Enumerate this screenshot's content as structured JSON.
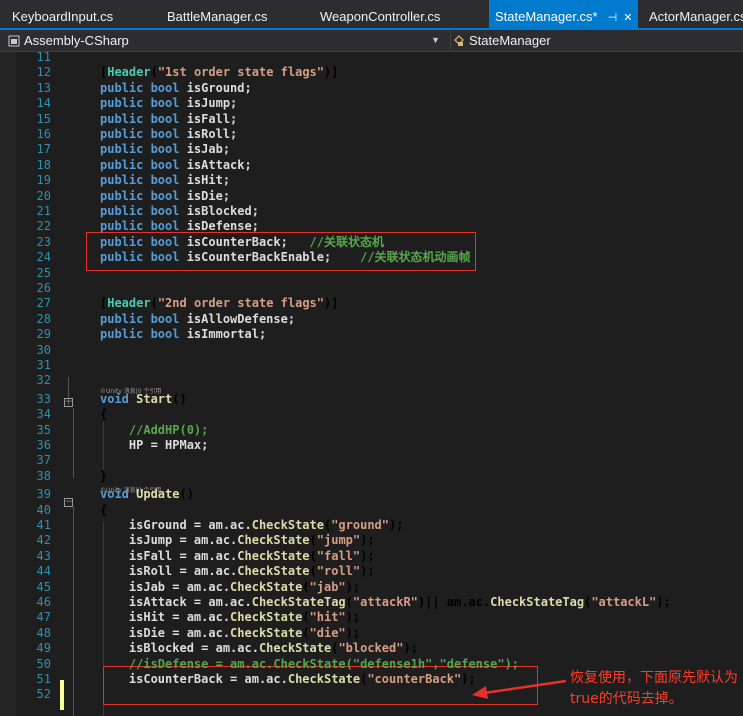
{
  "tabs": [
    {
      "label": "KeyboardInput.cs"
    },
    {
      "label": "BattleManager.cs"
    },
    {
      "label": "WeaponController.cs"
    },
    {
      "label": "StateManager.cs*",
      "active": true
    },
    {
      "label": "ActorManager.cs"
    }
  ],
  "nav": {
    "project": "Assembly-CSharp",
    "class": "StateManager"
  },
  "codelens": "©Unity 消息|0 个引用",
  "lines": [
    {
      "n": "11",
      "t": []
    },
    {
      "n": "12",
      "t": [
        [
          "[",
          ""
        ],
        [
          "Header",
          "ty"
        ],
        [
          "(",
          ""
        ],
        [
          "\"1st order state flags\"",
          "str"
        ],
        [
          ")]",
          ""
        ]
      ]
    },
    {
      "n": "13",
      "t": [
        [
          "public ",
          "kw"
        ],
        [
          "bool ",
          "kw"
        ],
        [
          "isGround;",
          "id"
        ]
      ]
    },
    {
      "n": "14",
      "t": [
        [
          "public ",
          "kw"
        ],
        [
          "bool ",
          "kw"
        ],
        [
          "isJump;",
          "id"
        ]
      ]
    },
    {
      "n": "15",
      "t": [
        [
          "public ",
          "kw"
        ],
        [
          "bool ",
          "kw"
        ],
        [
          "isFall;",
          "id"
        ]
      ]
    },
    {
      "n": "16",
      "t": [
        [
          "public ",
          "kw"
        ],
        [
          "bool ",
          "kw"
        ],
        [
          "isRoll;",
          "id"
        ]
      ]
    },
    {
      "n": "17",
      "t": [
        [
          "public ",
          "kw"
        ],
        [
          "bool ",
          "kw"
        ],
        [
          "isJab;",
          "id"
        ]
      ]
    },
    {
      "n": "18",
      "t": [
        [
          "public ",
          "kw"
        ],
        [
          "bool ",
          "kw"
        ],
        [
          "isAttack;",
          "id"
        ]
      ]
    },
    {
      "n": "19",
      "t": [
        [
          "public ",
          "kw"
        ],
        [
          "bool ",
          "kw"
        ],
        [
          "isHit;",
          "id"
        ]
      ]
    },
    {
      "n": "20",
      "t": [
        [
          "public ",
          "kw"
        ],
        [
          "bool ",
          "kw"
        ],
        [
          "isDie;",
          "id"
        ]
      ]
    },
    {
      "n": "21",
      "t": [
        [
          "public ",
          "kw"
        ],
        [
          "bool ",
          "kw"
        ],
        [
          "isBlocked;",
          "id"
        ]
      ]
    },
    {
      "n": "22",
      "t": [
        [
          "public ",
          "kw"
        ],
        [
          "bool ",
          "kw"
        ],
        [
          "isDefense;",
          "id"
        ]
      ]
    },
    {
      "n": "23",
      "t": [
        [
          "public ",
          "kw"
        ],
        [
          "bool ",
          "kw"
        ],
        [
          "isCounterBack;   ",
          "id"
        ],
        [
          "//关联状态机",
          "cm"
        ]
      ]
    },
    {
      "n": "24",
      "t": [
        [
          "public ",
          "kw"
        ],
        [
          "bool ",
          "kw"
        ],
        [
          "isCounterBackEnable;    ",
          "id"
        ],
        [
          "//关联状态机动画帧",
          "cm"
        ]
      ]
    },
    {
      "n": "25",
      "t": []
    },
    {
      "n": "26",
      "t": []
    },
    {
      "n": "27",
      "t": [
        [
          "[",
          ""
        ],
        [
          "Header",
          "ty"
        ],
        [
          "(",
          ""
        ],
        [
          "\"2nd order state flags\"",
          "str"
        ],
        [
          ")]",
          ""
        ]
      ]
    },
    {
      "n": "28",
      "t": [
        [
          "public ",
          "kw"
        ],
        [
          "bool ",
          "kw"
        ],
        [
          "isAllowDefense;",
          "id"
        ]
      ]
    },
    {
      "n": "29",
      "t": [
        [
          "public ",
          "kw"
        ],
        [
          "bool ",
          "kw"
        ],
        [
          "isImmortal;",
          "id"
        ]
      ]
    },
    {
      "n": "30",
      "t": []
    },
    {
      "n": "31",
      "t": []
    },
    {
      "n": "32",
      "t": []
    },
    {
      "n": "33",
      "t": [
        [
          "void ",
          "kw"
        ],
        [
          "Start",
          "fn"
        ],
        [
          "()",
          ""
        ]
      ]
    },
    {
      "n": "34",
      "t": [
        [
          "{",
          ""
        ]
      ]
    },
    {
      "n": "35",
      "t": [
        [
          "    //AddHP(0);",
          "cm"
        ]
      ]
    },
    {
      "n": "36",
      "t": [
        [
          "    HP = HPMax;",
          "id"
        ]
      ]
    },
    {
      "n": "37",
      "t": []
    },
    {
      "n": "38",
      "t": [
        [
          "}",
          ""
        ]
      ]
    },
    {
      "n": "39",
      "t": [
        [
          "void ",
          "kw"
        ],
        [
          "Update",
          "fn"
        ],
        [
          "()",
          ""
        ]
      ]
    },
    {
      "n": "40",
      "t": [
        [
          "{",
          ""
        ]
      ]
    },
    {
      "n": "41",
      "t": [
        [
          "    isGround = am.ac.",
          "id"
        ],
        [
          "CheckState",
          "fn"
        ],
        [
          "(",
          ""
        ],
        [
          "\"ground\"",
          "str"
        ],
        [
          ");",
          ""
        ]
      ]
    },
    {
      "n": "42",
      "t": [
        [
          "    isJump = am.ac.",
          "id"
        ],
        [
          "CheckState",
          "fn"
        ],
        [
          "(",
          ""
        ],
        [
          "\"jump\"",
          "str"
        ],
        [
          ");",
          ""
        ]
      ]
    },
    {
      "n": "43",
      "t": [
        [
          "    isFall = am.ac.",
          "id"
        ],
        [
          "CheckState",
          "fn"
        ],
        [
          "(",
          ""
        ],
        [
          "\"fall\"",
          "str"
        ],
        [
          ");",
          ""
        ]
      ]
    },
    {
      "n": "44",
      "t": [
        [
          "    isRoll = am.ac.",
          "id"
        ],
        [
          "CheckState",
          "fn"
        ],
        [
          "(",
          ""
        ],
        [
          "\"roll\"",
          "str"
        ],
        [
          ");",
          ""
        ]
      ]
    },
    {
      "n": "45",
      "t": [
        [
          "    isJab = am.ac.",
          "id"
        ],
        [
          "CheckState",
          "fn"
        ],
        [
          "(",
          ""
        ],
        [
          "\"jab\"",
          "str"
        ],
        [
          ");",
          ""
        ]
      ]
    },
    {
      "n": "46",
      "t": [
        [
          "    isAttack = am.ac.",
          "id"
        ],
        [
          "CheckStateTag",
          "fn"
        ],
        [
          "(",
          ""
        ],
        [
          "\"attackR\"",
          "str"
        ],
        [
          ")|| am.ac.",
          ""
        ],
        [
          "CheckStateTag",
          "fn"
        ],
        [
          "(",
          ""
        ],
        [
          "\"attackL\"",
          "str"
        ],
        [
          ");",
          ""
        ]
      ]
    },
    {
      "n": "47",
      "t": [
        [
          "    isHit = am.ac.",
          "id"
        ],
        [
          "CheckState",
          "fn"
        ],
        [
          "(",
          ""
        ],
        [
          "\"hit\"",
          "str"
        ],
        [
          ");",
          ""
        ]
      ]
    },
    {
      "n": "48",
      "t": [
        [
          "    isDie = am.ac.",
          "id"
        ],
        [
          "CheckState",
          "fn"
        ],
        [
          "(",
          ""
        ],
        [
          "\"die\"",
          "str"
        ],
        [
          ");",
          ""
        ]
      ]
    },
    {
      "n": "49",
      "t": [
        [
          "    isBlocked = am.ac.",
          "id"
        ],
        [
          "CheckState",
          "fn"
        ],
        [
          "(",
          ""
        ],
        [
          "\"blocked\"",
          "str"
        ],
        [
          ");",
          ""
        ]
      ]
    },
    {
      "n": "50",
      "t": [
        [
          "    //isDefense = am.ac.CheckState(\"defense1h\",\"defense\");",
          "cm"
        ]
      ]
    },
    {
      "n": "51",
      "t": [
        [
          "    isCounterBack = am.ac.",
          "id"
        ],
        [
          "CheckState",
          "fn"
        ],
        [
          "(",
          ""
        ],
        [
          "\"counterBack\"",
          "str"
        ],
        [
          ");",
          ""
        ]
      ]
    },
    {
      "n": "52",
      "t": []
    }
  ],
  "annotation": {
    "note": "恢复使用，下面原先默认为true的代码去掉。",
    "color": "#ff3c28"
  },
  "colors": {
    "keyword": "#569cd6",
    "type": "#4ec9b0",
    "method": "#dcdcaa",
    "string": "#d69d85",
    "comment": "#57a64a",
    "line_number": "#2b91af",
    "tab_active": "#007acc",
    "editor_bg": "#1e1e1e"
  }
}
